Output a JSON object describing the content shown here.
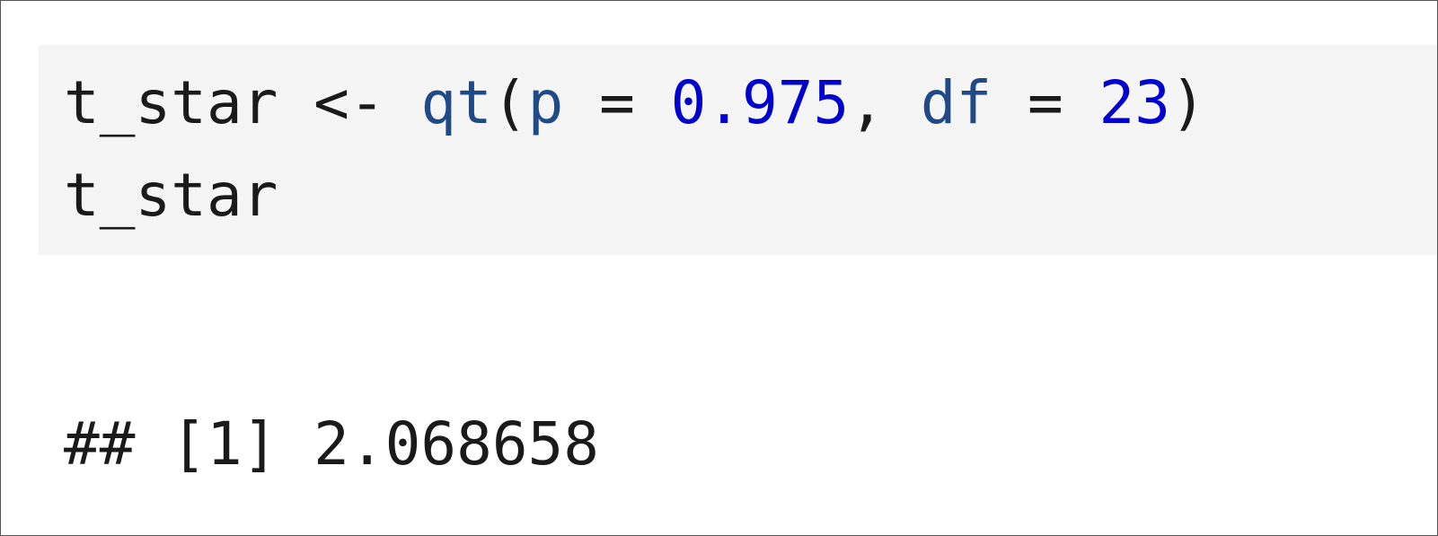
{
  "code": {
    "line1": {
      "var": "t_star",
      "assign": " <- ",
      "fn": "qt",
      "open": "(",
      "arg1_name": "p",
      "eq1": " = ",
      "arg1_value": "0.975",
      "comma": ", ",
      "arg2_name": "df",
      "eq2": " = ",
      "arg2_value": "23",
      "close": ")"
    },
    "line2": {
      "text": "t_star"
    }
  },
  "output": {
    "text": "## [1] 2.068658"
  },
  "colors": {
    "code_background": "#f5f5f5",
    "function": "#204a87",
    "argument": "#204a87",
    "number": "#0000cf",
    "text": "#1a1a1a"
  }
}
